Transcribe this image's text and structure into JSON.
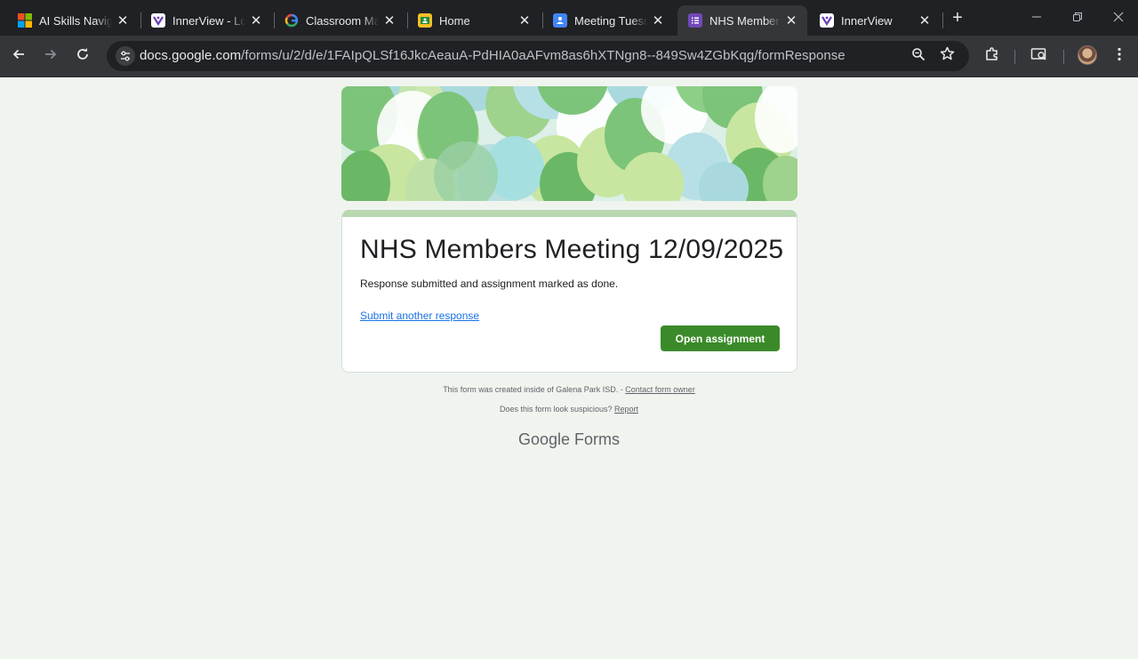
{
  "browser": {
    "tabs": [
      {
        "title": "AI Skills Navigator",
        "icon": "microsoft-icon",
        "active": false
      },
      {
        "title": "InnerView - Login",
        "icon": "innerview-icon",
        "active": false
      },
      {
        "title": "Classroom Management",
        "icon": "google-icon",
        "active": false
      },
      {
        "title": "Home",
        "icon": "classroom-icon",
        "active": false
      },
      {
        "title": "Meeting Tuesday",
        "icon": "user-doc-icon",
        "active": false
      },
      {
        "title": "NHS Members",
        "icon": "forms-icon",
        "active": true
      },
      {
        "title": "InnerView",
        "icon": "innerview-icon",
        "active": false
      }
    ],
    "new_tab": "+",
    "url_host": "docs.google.com",
    "url_path": "/forms/u/2/d/e/1FAIpQLSf16JkcAeauA-PdHIA0aAFvm8as6hXTNgn8--849Sw4ZGbKqg/formResponse"
  },
  "form": {
    "title": "NHS Members Meeting 12/09/2025",
    "confirmation": "Response submitted and assignment marked as done.",
    "submit_another": "Submit another response",
    "open_assignment": "Open assignment"
  },
  "footer": {
    "created_text": "This form was created inside of Galena Park ISD. - ",
    "contact_link": "Contact form owner",
    "suspicious_text": "Does this form look suspicious? ",
    "report_link": "Report",
    "brand_google": "Google",
    "brand_forms": "Forms"
  },
  "colors": {
    "accent": "#3a8a2a",
    "link": "#1a73e8",
    "background": "#f0f4ef"
  }
}
